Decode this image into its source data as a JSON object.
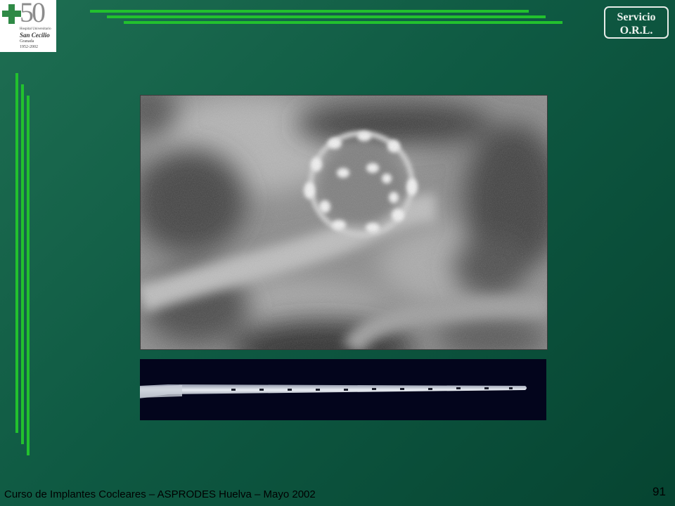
{
  "logo": {
    "number": "50",
    "line1": "Hospital Universitario",
    "line2": "San Cecilio",
    "line3": "Granada",
    "line4": "1952-2002"
  },
  "badge": {
    "line1": "Servicio",
    "line2": "O.R.L."
  },
  "footer": {
    "text": "Curso de Implantes Cocleares – ASPRODES Huelva – Mayo 2002",
    "page_number": "91"
  },
  "colors": {
    "background": "#0f5a43",
    "accent_lines": "#22c12e"
  }
}
